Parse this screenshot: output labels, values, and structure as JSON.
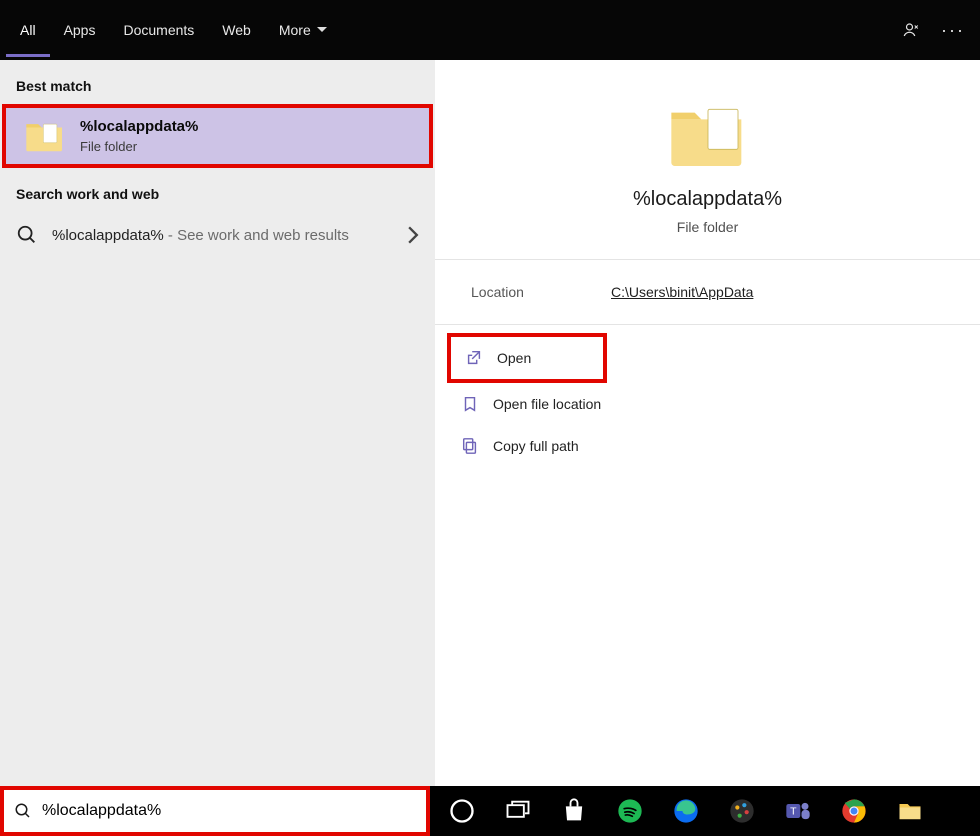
{
  "top_tabs": {
    "all": "All",
    "apps": "Apps",
    "documents": "Documents",
    "web": "Web",
    "more": "More"
  },
  "left": {
    "best_match_label": "Best match",
    "best_match": {
      "title": "%localappdata%",
      "subtitle": "File folder"
    },
    "search_web_label": "Search work and web",
    "web_item": {
      "query": "%localappdata%",
      "suffix": " - See work and web results"
    }
  },
  "preview": {
    "title": "%localappdata%",
    "subtitle": "File folder",
    "location_label": "Location",
    "location_value": "C:\\Users\\binit\\AppData"
  },
  "actions": {
    "open": "Open",
    "open_location": "Open file location",
    "copy_path": "Copy full path"
  },
  "taskbar": {
    "search_value": "%localappdata%"
  }
}
